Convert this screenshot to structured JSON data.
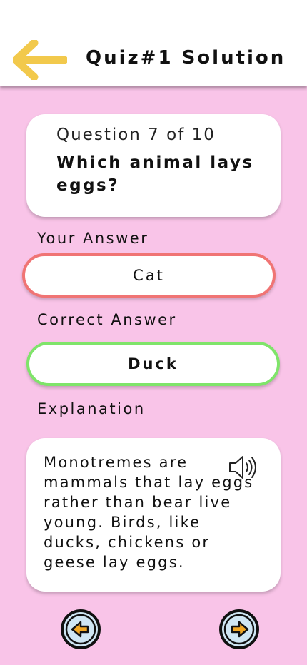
{
  "header": {
    "title": "Quiz#1 Solution"
  },
  "question": {
    "counter": "Question 7 of 10",
    "text": "Which animal lays eggs?"
  },
  "your_answer": {
    "label": "Your Answer",
    "value": "Cat"
  },
  "correct_answer": {
    "label": "Correct Answer",
    "value": "Duck"
  },
  "explanation": {
    "label": "Explanation",
    "text": "Monotremes are mammals that lay eggs rather than bear live young. Birds, like ducks, chickens or geese lay eggs."
  },
  "icons": {
    "back": "arrow-left-icon",
    "speaker": "speaker-icon",
    "prev": "prev-arrow-icon",
    "next": "next-arrow-icon"
  },
  "colors": {
    "background": "#f9c4e8",
    "wrong_border": "#f07474",
    "correct_border": "#7fe46a",
    "back_arrow": "#f2c94c",
    "nav_button_fill": "#cfe6f3",
    "nav_arrow": "#f0a623"
  }
}
